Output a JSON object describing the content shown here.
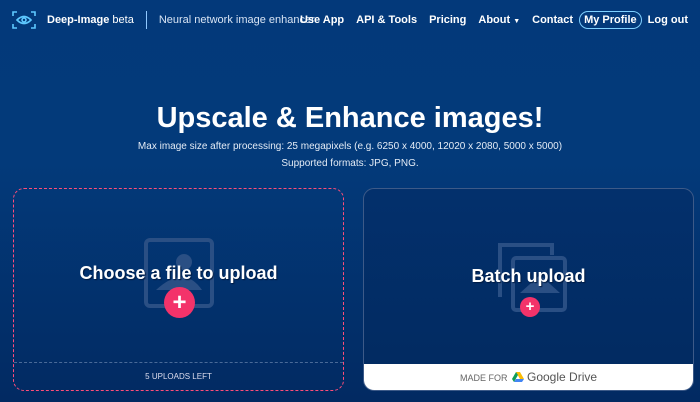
{
  "nav": {
    "brand": "Deep-Image",
    "beta": "beta",
    "tagline": "Neural network image enhancer",
    "items": [
      "Use App",
      "API & Tools",
      "Pricing",
      "About",
      "Contact",
      "My Profile",
      "Log out"
    ]
  },
  "hero": {
    "title": "Upscale & Enhance images!",
    "max_size": "Max image size after processing: 25 megapixels (e.g. 6250 x 4000, 12020 x 2080, 5000 x 5000)",
    "formats": "Supported formats: JPG, PNG."
  },
  "upload": {
    "title": "Choose a file to upload",
    "plus": "+",
    "remaining": "5 UPLOADS LEFT"
  },
  "batch": {
    "title": "Batch upload",
    "plus": "+",
    "made_for": "MADE FOR",
    "drive": "Google Drive"
  }
}
